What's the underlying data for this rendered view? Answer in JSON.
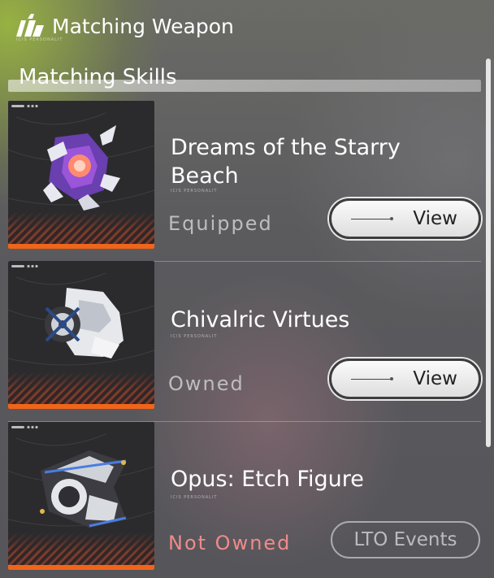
{
  "header": {
    "title": "Matching Weapon",
    "sub": "ICIS PERSONALIT"
  },
  "section": {
    "title": "Matching Skills"
  },
  "items": [
    {
      "name": "Dreams of the Starry Beach",
      "sub": "ICIS PERSONALIT",
      "status": "Equipped",
      "status_color": "#bdbdbd",
      "action": "View"
    },
    {
      "name": "Chivalric Virtues",
      "sub": "ICIS PERSONALIT",
      "status": "Owned",
      "status_color": "#bdbdbd",
      "action": "View"
    },
    {
      "name": "Opus: Etch Figure",
      "sub": "ICIS PERSONALIT",
      "status": "Not Owned",
      "status_color": "#f08a8a",
      "action": "LTO Events"
    }
  ],
  "colors": {
    "accent_orange": "#f0651a",
    "not_owned": "#f08a8a"
  },
  "icons": [
    "brand-logo-icon",
    "weapon-crystal-icon",
    "weapon-armor-icon",
    "weapon-cannon-icon",
    "link-line-icon"
  ]
}
